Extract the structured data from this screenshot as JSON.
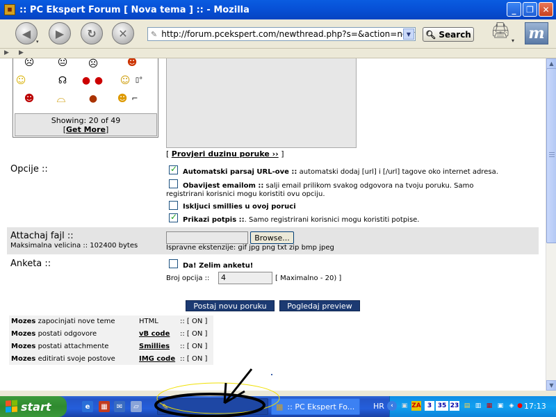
{
  "window": {
    "title": ":: PC Ekspert Forum [ Nova tema ] :: - Mozilla",
    "minimize": "_",
    "maximize": "❐",
    "close": "✕"
  },
  "toolbar": {
    "url": "http://forum.pcekspert.com/newthread.php?s=&action=newthread&fo",
    "search_label": "Search",
    "back": "back-icon",
    "forward": "forward-icon",
    "reload": "reload-icon",
    "stop": "stop-icon"
  },
  "smilies": {
    "showing": "Showing: 20 of 49",
    "get_more": "Get More"
  },
  "check_length": {
    "open": "[",
    "link": "Provjeri duzinu poruke ››",
    "close": "]"
  },
  "options": {
    "heading": "Opcije ::",
    "items": [
      {
        "bold": "Automatski parsaj URL-ove ::",
        "text": "automatski dodaj [url] i [/url] tagove oko internet adresa.",
        "checked": true
      },
      {
        "bold": "Obavijest emailom ::",
        "text": "salji email prilikom svakog odgovora na tvoju poruku. Samo",
        "text2": "registrirani korisnici mogu koristiti ovu opciju.",
        "checked": false
      },
      {
        "bold": "Iskljuci smillies u ovoj poruci",
        "text": "",
        "checked": false
      },
      {
        "bold": "Prikazi potpis ::",
        "text": ". Samo registrirani korisnici mogu koristiti potpise.",
        "checked": true
      }
    ]
  },
  "attach": {
    "heading": "Attachaj fajl ::",
    "sub": "Maksimalna velicina :: 102400 bytes",
    "browse": "Browse...",
    "extensions": "Ispravne ekstenzije: gif jpg png txt zip bmp jpeg"
  },
  "poll": {
    "heading": "Anketa ::",
    "checkbox_label": "Da! Zelim anketu!",
    "count_label": "Broj opcija ::",
    "count_value": "4",
    "max_label": "[ Maximalno - 20) ]"
  },
  "buttons": {
    "post": "Postaj novu poruku",
    "preview": "Pogledaj preview"
  },
  "permissions": [
    {
      "bold": "Mozes",
      "text": "zapocinjati nove teme",
      "col2": "HTML",
      "col2_link": false,
      "col3": ":: [ ON ]"
    },
    {
      "bold": "Mozes",
      "text": "postati odgovore",
      "col2": "vB code",
      "col2_link": true,
      "col3": ":: [ ON ]"
    },
    {
      "bold": "Mozes",
      "text": "postati attachmente",
      "col2": "Smillies",
      "col2_link": true,
      "col3": ":: [ ON ]"
    },
    {
      "bold": "Mozes",
      "text": "editirati svoje postove",
      "col2": "IMG code",
      "col2_link": true,
      "col3": ":: [ ON ]"
    }
  ],
  "taskbar": {
    "start": "start",
    "task_item": ":: PC Ekspert Fo...",
    "lang": "HR",
    "clock": "17:13",
    "tray_numbers": [
      "3",
      "35",
      "23"
    ]
  },
  "colors": {
    "titlebar": "#0752d8",
    "button_dark": "#1c3a72",
    "section_gray": "#e4e4e4",
    "annotation_black": "#000000",
    "annotation_yellow": "#f0e000"
  }
}
